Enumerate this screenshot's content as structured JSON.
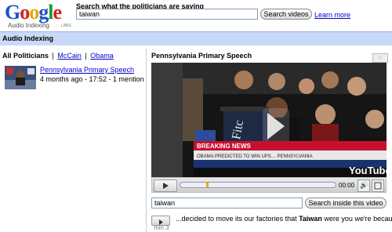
{
  "header": {
    "logo_letters": [
      {
        "ch": "G",
        "color": "#1a53c8"
      },
      {
        "ch": "o",
        "color": "#d4221a"
      },
      {
        "ch": "o",
        "color": "#e5a700"
      },
      {
        "ch": "g",
        "color": "#1a53c8"
      },
      {
        "ch": "l",
        "color": "#169c35"
      },
      {
        "ch": "e",
        "color": "#d4221a"
      }
    ],
    "logo_subtitle": "Audio Indexing",
    "logo_labs": "LABS",
    "prompt": "Search what the politicians are saying",
    "search_value": "taiwan",
    "search_button": "Search videos",
    "learn_more": "Learn more"
  },
  "section": {
    "title": "Audio Indexing"
  },
  "filters": {
    "all": "All Politicians",
    "sep": "|",
    "mccain": "McCain",
    "obama": "Obama"
  },
  "result": {
    "title": "Pennsylvania Primary Speech",
    "meta": "4 months ago - 17:52 - 1 mention"
  },
  "video": {
    "title": "Pennsylvania Primary Speech",
    "podium_text": "Fitc",
    "ticker_headline": "BREAKING NEWS",
    "ticker_text": "OBAMA PREDICTED TO WIN UPS… PENNSYLVANIA",
    "youtube_label": "YouTube",
    "time": "00:00",
    "progress_fraction": 0.17
  },
  "inside": {
    "value": "taiwan",
    "button": "Search inside this video"
  },
  "transcript": {
    "min_label": "min 3",
    "before": "...decided to move its our factories that ",
    "highlight": "Taiwan",
    "after": " were you we're because ..."
  }
}
